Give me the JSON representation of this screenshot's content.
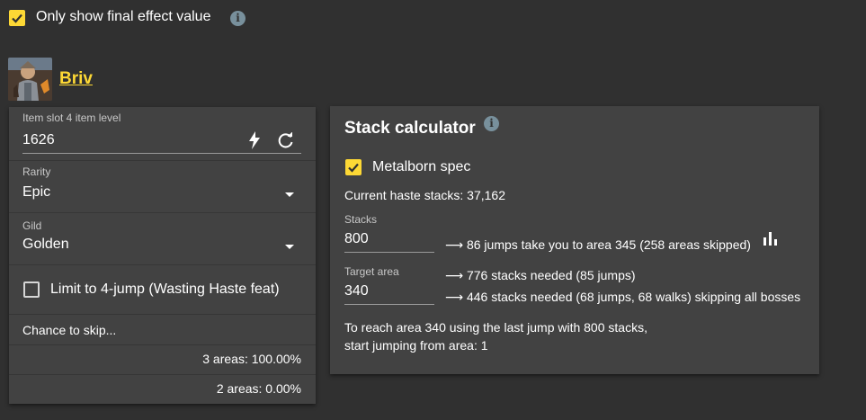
{
  "top": {
    "only_final_label": "Only show final effect value",
    "only_final_checked": true
  },
  "champion": {
    "name": "Briv",
    "avatar_icon": "briv-portrait-icon"
  },
  "item_panel": {
    "item_level_label": "Item slot 4 item level",
    "item_level_value": "1626",
    "rarity_label": "Rarity",
    "rarity_value": "Epic",
    "gild_label": "Gild",
    "gild_value": "Golden",
    "limit_label": "Limit to 4-jump (Wasting Haste feat)",
    "limit_checked": false,
    "chance_label": "Chance to skip...",
    "chances": [
      "3 areas: 100.00%",
      "2 areas: 0.00%"
    ]
  },
  "stack_calc": {
    "title": "Stack calculator",
    "metalborn_label": "Metalborn spec",
    "metalborn_checked": true,
    "current_haste": "Current haste stacks: 37,162",
    "stacks_label": "Stacks",
    "stacks_value": "800",
    "stacks_result": "86 jumps take you to area 345 (258 areas skipped)",
    "target_label": "Target area",
    "target_value": "340",
    "target_result_1": "776 stacks needed (85 jumps)",
    "target_result_2": "446 stacks needed (68 jumps, 68 walks) skipping all bosses",
    "summary_line_1": "To reach area 340 using the last jump with 800 stacks,",
    "summary_line_2": "start jumping from area: 1"
  },
  "colors": {
    "accent": "#fdd835",
    "background": "#303030",
    "card": "#424242"
  }
}
